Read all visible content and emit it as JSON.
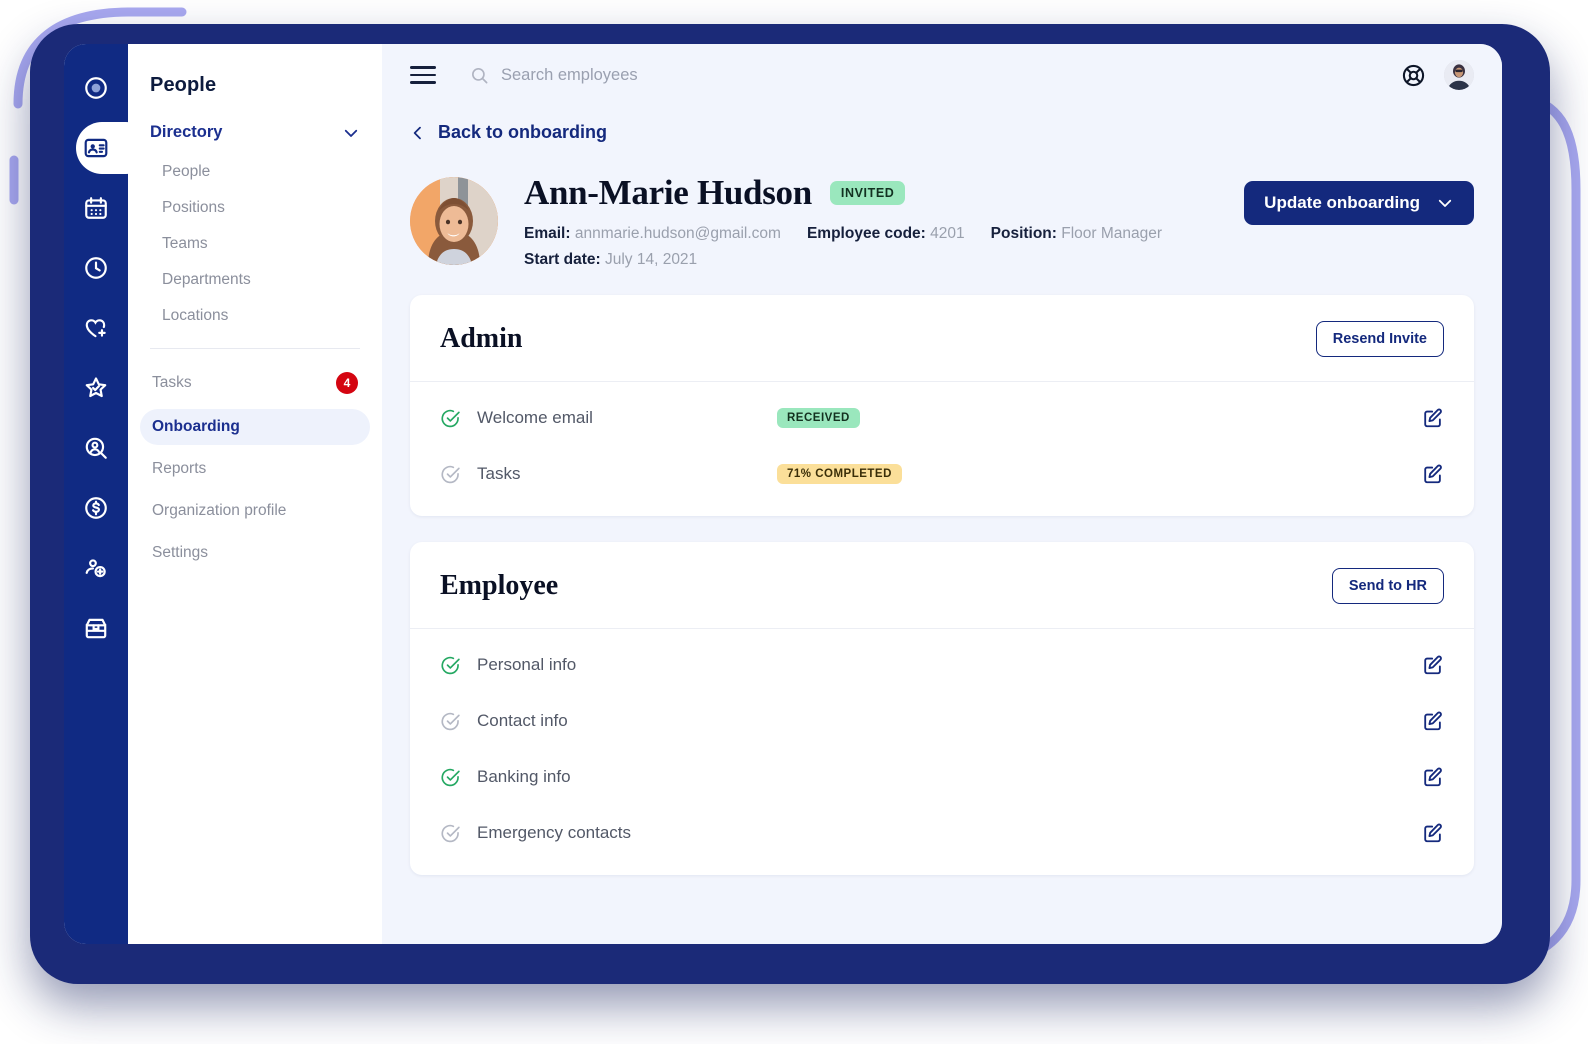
{
  "theme": {
    "navy": "#102a83",
    "deep_navy": "#14297d",
    "frame_navy": "#1b2a78",
    "periwinkle": "#a9a9f0",
    "canvas": "#f2f5fd",
    "green_badge": "#9ae7bd",
    "yellow_badge": "#fbdf99",
    "badge_red": "#d40511",
    "muted_text": "#8b8f9c"
  },
  "icon_rail": {
    "items": [
      {
        "name": "logo-icon",
        "title": "Logo",
        "active": false
      },
      {
        "name": "id-badge-icon",
        "title": "Directory",
        "active": true
      },
      {
        "name": "calendar-icon",
        "title": "Calendar",
        "active": false
      },
      {
        "name": "clock-icon",
        "title": "Time tracking",
        "active": false
      },
      {
        "name": "heart-plus-icon",
        "title": "Benefits",
        "active": false
      },
      {
        "name": "star-check-icon",
        "title": "Performance",
        "active": false
      },
      {
        "name": "person-search-icon",
        "title": "Recruiting",
        "active": false
      },
      {
        "name": "dollar-circle-icon",
        "title": "Payroll",
        "active": false
      },
      {
        "name": "person-add-icon",
        "title": "Onboarding",
        "active": false
      },
      {
        "name": "store-icon",
        "title": "Marketplace",
        "active": false
      }
    ]
  },
  "sidebar": {
    "title": "People",
    "section": {
      "label": "Directory",
      "expanded": true
    },
    "sub_items": [
      {
        "label": "People"
      },
      {
        "label": "Positions"
      },
      {
        "label": "Teams"
      },
      {
        "label": "Departments"
      },
      {
        "label": "Locations"
      }
    ],
    "items": [
      {
        "label": "Tasks",
        "badge": "4",
        "active": false
      },
      {
        "label": "Onboarding",
        "badge": "",
        "active": true
      },
      {
        "label": "Reports",
        "badge": "",
        "active": false
      },
      {
        "label": "Organization profile",
        "badge": "",
        "active": false
      },
      {
        "label": "Settings",
        "badge": "",
        "active": false
      }
    ]
  },
  "topbar": {
    "search_placeholder": "Search employees",
    "search_value": "",
    "help_icon": "lifebuoy-icon",
    "avatar_icon": "user-avatar"
  },
  "back_link": {
    "label": "Back to onboarding"
  },
  "profile": {
    "name": "Ann-Marie Hudson",
    "status": "INVITED",
    "email_label": "Email:",
    "email_value": "annmarie.hudson@gmail.com",
    "code_label": "Employee code:",
    "code_value": "4201",
    "position_label": "Position:",
    "position_value": "Floor Manager",
    "start_label": "Start date:",
    "start_value": "July 14, 2021",
    "action_button": "Update onboarding"
  },
  "cards": [
    {
      "title": "Admin",
      "action": "Resend Invite",
      "rows": [
        {
          "label": "Welcome email",
          "done": true,
          "badge": "RECEIVED",
          "badge_style": "green",
          "edit": "edit-icon"
        },
        {
          "label": "Tasks",
          "done": false,
          "badge": "71% COMPLETED",
          "badge_style": "yellow",
          "edit": "edit-icon"
        }
      ]
    },
    {
      "title": "Employee",
      "action": "Send to HR",
      "rows": [
        {
          "label": "Personal info",
          "done": true,
          "badge": "",
          "badge_style": "",
          "edit": "edit-icon"
        },
        {
          "label": "Contact info",
          "done": false,
          "badge": "",
          "badge_style": "",
          "edit": "edit-icon"
        },
        {
          "label": "Banking info",
          "done": true,
          "badge": "",
          "badge_style": "",
          "edit": "edit-icon"
        },
        {
          "label": "Emergency contacts",
          "done": false,
          "badge": "",
          "badge_style": "",
          "edit": "edit-icon"
        }
      ]
    }
  ]
}
